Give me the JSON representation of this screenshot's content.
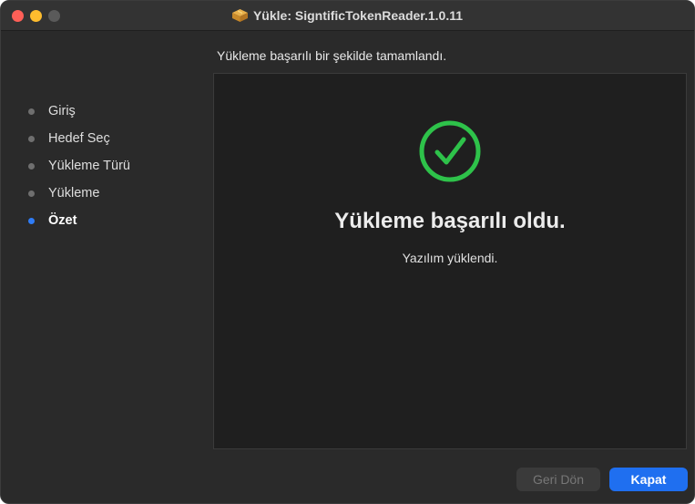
{
  "window": {
    "title": "Yükle: SigntificTokenReader.1.0.11"
  },
  "heading": "Yükleme başarılı bir şekilde tamamlandı.",
  "sidebar": {
    "steps": [
      {
        "label": "Giriş",
        "active": false
      },
      {
        "label": "Hedef Seç",
        "active": false
      },
      {
        "label": "Yükleme Türü",
        "active": false
      },
      {
        "label": "Yükleme",
        "active": false
      },
      {
        "label": "Özet",
        "active": true
      }
    ]
  },
  "result": {
    "title": "Yükleme başarılı oldu.",
    "subtitle": "Yazılım yüklendi.",
    "icon": "checkmark-circle-icon"
  },
  "buttons": {
    "back_label": "Geri Dön",
    "close_label": "Kapat"
  },
  "colors": {
    "accent": "#2f7cf6",
    "success": "#2ec24a",
    "background": "#2a2a2a"
  }
}
